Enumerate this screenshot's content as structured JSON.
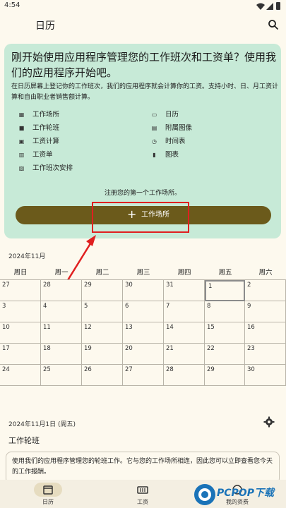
{
  "status_bar": {
    "time": "4:54"
  },
  "app_bar": {
    "title": "日历"
  },
  "welcome": {
    "heading": "刚开始使用应用程序管理您的工作班次和工资单？使用我们的应用程序开始吧。",
    "description": "在日历屏幕上登记你的工作班次，我们的应用程序就会计算你的工资。支持小时、日、月工资计算和自由职业者销售额计算。",
    "features": [
      {
        "label": "工作场所",
        "icon": "building-icon"
      },
      {
        "label": "日历",
        "icon": "calendar-icon"
      },
      {
        "label": "工作轮班",
        "icon": "briefcase-icon"
      },
      {
        "label": "附属图像",
        "icon": "images-icon"
      },
      {
        "label": "工资计算",
        "icon": "calculator-icon"
      },
      {
        "label": "时间表",
        "icon": "clock-icon"
      },
      {
        "label": "工资单",
        "icon": "receipt-icon"
      },
      {
        "label": "图表",
        "icon": "chart-icon"
      },
      {
        "label": "工作班次安排",
        "icon": "schedule-icon"
      }
    ],
    "register_text": "注册您的第一个工作场所。",
    "register_button": "工作场所"
  },
  "calendar": {
    "month_label": "2024年11月",
    "weekdays": [
      "周日",
      "周一",
      "周二",
      "周三",
      "周四",
      "周五",
      "周六"
    ],
    "weeks": [
      [
        "27",
        "28",
        "29",
        "30",
        "31",
        "1",
        "2"
      ],
      [
        "3",
        "4",
        "5",
        "6",
        "7",
        "8",
        "9"
      ],
      [
        "10",
        "11",
        "12",
        "13",
        "14",
        "15",
        "16"
      ],
      [
        "17",
        "18",
        "19",
        "20",
        "21",
        "22",
        "23"
      ],
      [
        "24",
        "25",
        "26",
        "27",
        "28",
        "29",
        "30"
      ]
    ],
    "today": "1"
  },
  "selected": {
    "date_label": "2024年11月1日 (周五)",
    "shift_title": "工作轮班",
    "shift_text": "使用我们的应用程序管理您的轮班工作。它与您的工作场所相连，因此您可以立即查看您今天的工作报酬。"
  },
  "bottom_nav": [
    {
      "label": "日历",
      "icon": "calendar-icon",
      "active": true
    },
    {
      "label": "工资",
      "icon": "payroll-icon",
      "active": false
    },
    {
      "label": "我的资费",
      "icon": "tariff-icon",
      "active": false
    }
  ],
  "watermark": {
    "text": "PCPOP下载"
  },
  "colors": {
    "accent": "#6b5a1b",
    "card": "#c7ead7",
    "background": "#fdf9ee",
    "highlight": "#e02020"
  }
}
